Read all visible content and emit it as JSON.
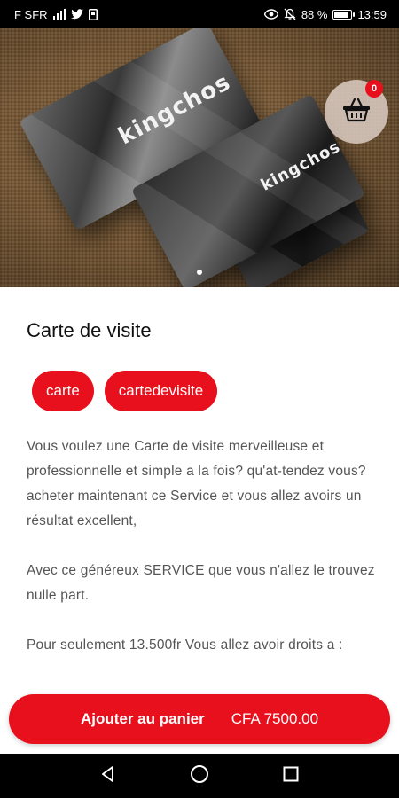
{
  "status_bar": {
    "carrier": "F SFR",
    "battery_text": "88 %",
    "time": "13:59",
    "battery_level": 0.88
  },
  "hero": {
    "card_brand": "kingchos",
    "cart_count": "0",
    "carousel_index": 1,
    "carousel_total": 1
  },
  "product": {
    "title": "Carte de visite",
    "tags": [
      "carte",
      "cartedevisite"
    ],
    "description": [
      "Vous voulez une Carte de visite merveilleuse et professionnelle et simple a la fois? qu'at-tendez vous? acheter maintenant ce Service et vous allez avoirs un résultat excellent,",
      "Avec ce généreux SERVICE que vous n'allez le trouvez nulle part.",
      "Pour seulement 13.500fr Vous allez avoir droits a :"
    ]
  },
  "action": {
    "add_label": "Ajouter au panier",
    "price": "CFA 7500.00"
  },
  "colors": {
    "accent": "#e8101c"
  }
}
